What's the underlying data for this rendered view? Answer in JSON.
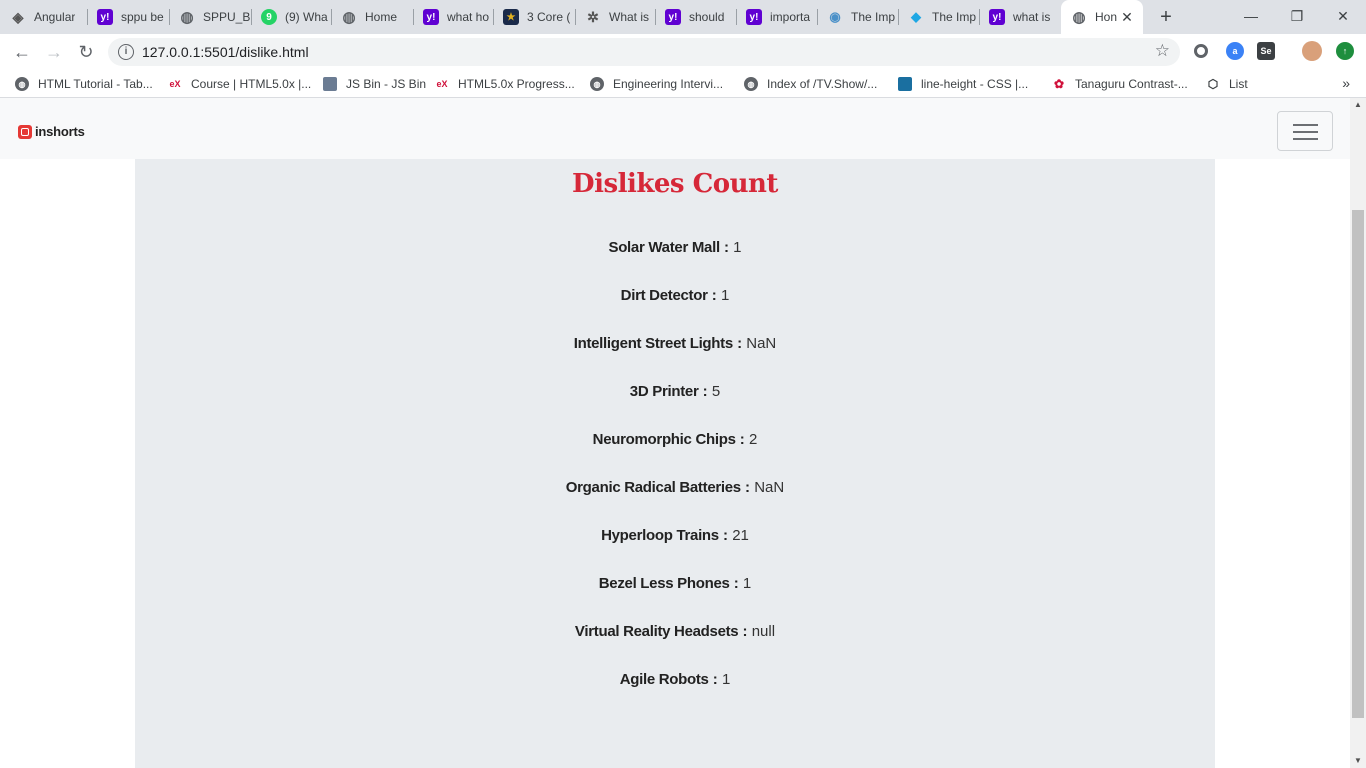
{
  "browser": {
    "tabs": [
      {
        "title": "Angular",
        "icon": "angular-icon",
        "color": "#555555"
      },
      {
        "title": "sppu be",
        "icon": "yahoo-icon",
        "color": "#6001d2"
      },
      {
        "title": "SPPU_B",
        "icon": "globe-icon",
        "color": "#5f6368"
      },
      {
        "title": "(9) Wha",
        "icon": "whatsapp-icon",
        "color": "#25d366"
      },
      {
        "title": "Home",
        "icon": "globe-icon",
        "color": "#5f6368"
      },
      {
        "title": "what ho",
        "icon": "yahoo-icon",
        "color": "#6001d2"
      },
      {
        "title": "3 Core (",
        "icon": "site-icon",
        "color": "#1a2a4a"
      },
      {
        "title": "What is",
        "icon": "tree-icon",
        "color": "#555555"
      },
      {
        "title": "should",
        "icon": "yahoo-icon",
        "color": "#6001d2"
      },
      {
        "title": "importa",
        "icon": "yahoo-icon",
        "color": "#6001d2"
      },
      {
        "title": "The Imp",
        "icon": "eye-icon",
        "color": "#4a90c8"
      },
      {
        "title": "The Imp",
        "icon": "diamond-icon",
        "color": "#1ea7e4"
      },
      {
        "title": "what is",
        "icon": "yahoo-icon",
        "color": "#6001d2"
      },
      {
        "title": "Hon",
        "icon": "globe-icon",
        "color": "#5f6368"
      }
    ],
    "url": "127.0.0.1:5501/dislike.html",
    "bookmarks": [
      {
        "title": "HTML Tutorial - Tab...",
        "icon": "globe-icon"
      },
      {
        "title": "Course | HTML5.0x |...",
        "icon": "edx-icon"
      },
      {
        "title": "JS Bin - JS Bin",
        "icon": "jsbin-icon"
      },
      {
        "title": "HTML5.0x Progress...",
        "icon": "edx-icon"
      },
      {
        "title": "Engineering Intervi...",
        "icon": "globe-icon"
      },
      {
        "title": "Index of /TV.Show/...",
        "icon": "globe-icon"
      },
      {
        "title": "line-height - CSS |...",
        "icon": "mdn-icon"
      },
      {
        "title": "Tanaguru Contrast-...",
        "icon": "tanaguru-icon"
      },
      {
        "title": "List",
        "icon": "codepen-icon"
      }
    ],
    "more_bookmarks": "»"
  },
  "navbar": {
    "logo_text": "inshorts"
  },
  "page": {
    "heading": "Dislikes Count",
    "separator": ":",
    "items": [
      {
        "name": "Solar Water Mall",
        "value": "1"
      },
      {
        "name": "Dirt Detector",
        "value": "1"
      },
      {
        "name": "Intelligent Street Lights",
        "value": "NaN"
      },
      {
        "name": "3D Printer",
        "value": "5"
      },
      {
        "name": "Neuromorphic Chips",
        "value": "2"
      },
      {
        "name": "Organic Radical Batteries",
        "value": "NaN"
      },
      {
        "name": "Hyperloop Trains",
        "value": "21"
      },
      {
        "name": "Bezel Less Phones",
        "value": "1"
      },
      {
        "name": "Virtual Reality Headsets",
        "value": "null"
      },
      {
        "name": "Agile Robots",
        "value": "1"
      }
    ]
  }
}
